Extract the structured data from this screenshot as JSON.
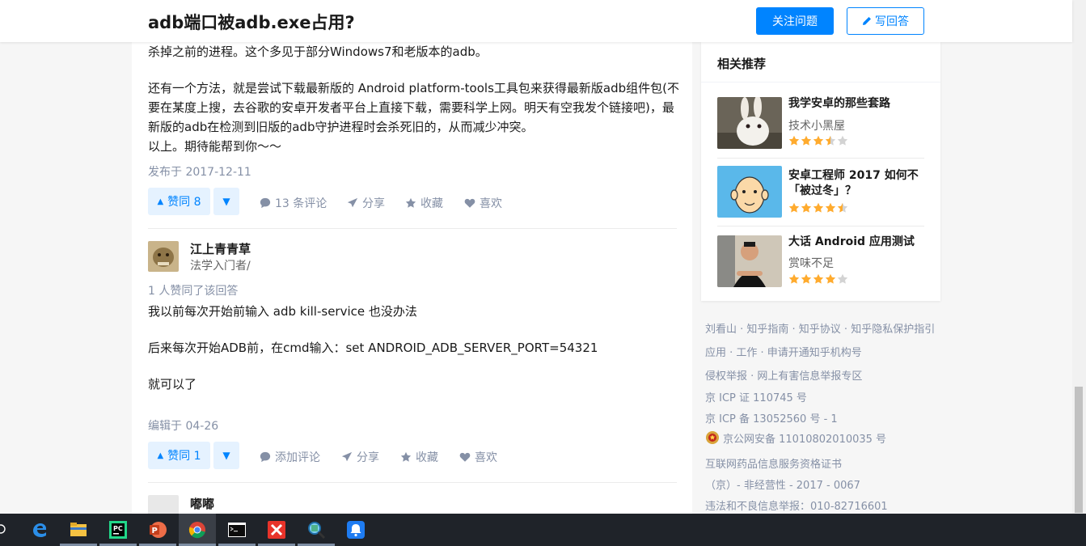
{
  "header": {
    "question_title": "adb端口被adb.exe占用?",
    "follow_label": "关注问题",
    "write_label": "写回答"
  },
  "answer1": {
    "line1": "杀掉之前的进程。这个多见于部分Windows7和老版本的adb。",
    "para2_l1": "还有一个方法，就是尝试下载最新版的 Android platform-tools工具包来获得最新版adb组件包(不",
    "para2_l2": "要在某度上搜，去谷歌的安卓开发者平台上直接下载，需要科学上网。明天有空我发个链接吧)，最",
    "para2_l3": "新版的adb在检测到旧版的adb守护进程时会杀死旧的，从而减少冲突。",
    "para2_l4": "以上。期待能帮到你～～",
    "date": "发布于 2017-12-11",
    "vote_label": "赞同 8",
    "comments": "13 条评论",
    "share": "分享",
    "collect": "收藏",
    "like": "喜欢"
  },
  "answer2": {
    "author": "江上青青草",
    "bio": "法学入门者/",
    "voters": "1 人赞同了该回答",
    "line1": "我以前每次开始前输入 adb kill-service 也没办法",
    "line2": "后来每次开始ADB前，在cmd输入：set ANDROID_ADB_SERVER_PORT=54321",
    "line3": "就可以了",
    "date": "编辑于 04-26",
    "vote_label": "赞同 1",
    "comments": "添加评论",
    "share": "分享",
    "collect": "收藏",
    "like": "喜欢"
  },
  "answer3": {
    "author": "嘟嘟"
  },
  "sidebar": {
    "title": "相关推荐",
    "items": [
      {
        "title": "我学安卓的那些套路",
        "author": "技术小黑屋",
        "rating": 3.5
      },
      {
        "title_l1": "安卓工程师 2017 如何不",
        "title_l2": "「被过冬」？",
        "rating": 4.5
      },
      {
        "title": "大话 Android 应用测试",
        "author": "赏味不足",
        "rating": 4
      }
    ]
  },
  "footer": {
    "l1": "刘看山 · 知乎指南 · 知乎协议 · 知乎隐私保护指引",
    "l2": "应用 · 工作 · 申请开通知乎机构号",
    "l3": "侵权举报 · 网上有害信息举报专区",
    "l4": "京 ICP 证 110745 号",
    "l5": "京 ICP 备 13052560 号 - 1",
    "l6": "京公网安备 11010802010035 号",
    "l7": "互联网药品信息服务资格证书",
    "l8": "（京）- 非经营性 - 2017 - 0067",
    "l9": "违法和不良信息举报：010-82716601"
  },
  "colors": {
    "brand_blue": "#0084ff",
    "star": "#ffab2e",
    "meta_gray": "#8590a6"
  },
  "taskbar": {
    "icons": [
      "edge-icon",
      "file-explorer-icon",
      "pycharm-icon",
      "powerpoint-icon",
      "chrome-icon",
      "terminal-icon",
      "xmind-icon",
      "search-tool-icon",
      "notification-icon"
    ]
  }
}
